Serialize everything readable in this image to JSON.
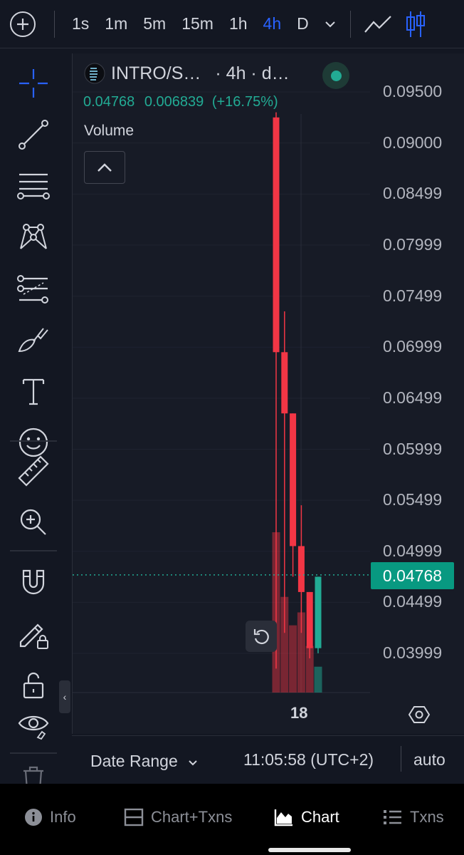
{
  "toolbar": {
    "add_icon": "plus-circle-icon",
    "timeframes": [
      "1s",
      "1m",
      "5m",
      "15m",
      "1h",
      "4h",
      "D"
    ],
    "active_timeframe": "4h",
    "chart_type_icons": [
      "line-chart-icon",
      "candles-icon"
    ]
  },
  "left_tools": [
    "crosshair-icon",
    "trendline-icon",
    "fib-retracement-icon",
    "pattern-icon",
    "forecast-icon",
    "brush-icon",
    "text-icon",
    "emoji-icon",
    "ruler-icon",
    "zoom-in-icon",
    "magnet-icon",
    "lock-drawing-icon",
    "unlock-icon",
    "eye-icon",
    "trash-icon"
  ],
  "legend": {
    "symbol": "INTRO/S…",
    "interval": "· 4h · d…",
    "last_price": "0.04768",
    "change": "0.006839",
    "change_pct": "(+16.75%)",
    "volume_label": "Volume"
  },
  "price_axis": [
    "0.09500",
    "0.09000",
    "0.08499",
    "0.07999",
    "0.07499",
    "0.06999",
    "0.06499",
    "0.05999",
    "0.05499",
    "0.04999",
    "0.04499",
    "0.03999"
  ],
  "current_price_tag": "0.04768",
  "time_axis": [
    "18"
  ],
  "bottom_bar": {
    "date_range": "Date Range",
    "clock": "11:05:58 (UTC+2)",
    "scale_mode": "auto"
  },
  "nav": [
    {
      "label": "Info",
      "icon": "info-icon"
    },
    {
      "label": "Chart+Txns",
      "icon": "split-view-icon"
    },
    {
      "label": "Chart",
      "icon": "area-chart-icon"
    },
    {
      "label": "Txns",
      "icon": "list-icon"
    }
  ],
  "active_nav": "Chart",
  "colors": {
    "up": "#22ab94",
    "down": "#f23645",
    "accent": "#2962ff",
    "background": "#131722"
  },
  "chart_data": {
    "type": "candlestick",
    "title": "",
    "x_tick_labels": [
      "18"
    ],
    "ylim": [
      0.0375,
      0.096
    ],
    "grid": true,
    "candles": [
      {
        "open": 0.0925,
        "high": 0.093,
        "low": 0.0385,
        "close": 0.0695
      },
      {
        "open": 0.0695,
        "high": 0.0735,
        "low": 0.042,
        "close": 0.0635
      },
      {
        "open": 0.0635,
        "high": 0.0635,
        "low": 0.0475,
        "close": 0.0505
      },
      {
        "open": 0.0505,
        "high": 0.0545,
        "low": 0.042,
        "close": 0.046
      },
      {
        "open": 0.046,
        "high": 0.046,
        "low": 0.0395,
        "close": 0.0405
      },
      {
        "open": 0.0405,
        "high": 0.0475,
        "low": 0.04,
        "close": 0.0475
      }
    ],
    "volume": [
      0.62,
      0.37,
      0.26,
      0.31,
      0.18,
      0.1
    ]
  }
}
